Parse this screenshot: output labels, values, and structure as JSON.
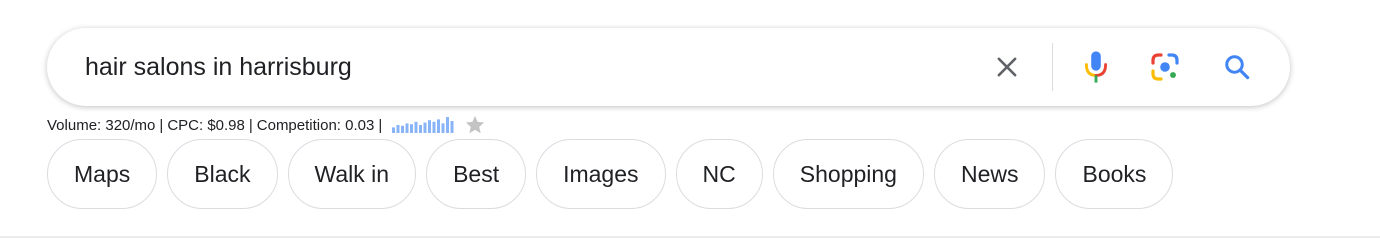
{
  "search": {
    "query": "hair salons in harrisburg"
  },
  "keyword_info": {
    "volume": "Volume: 320/mo",
    "cpc": "CPC: $0.98",
    "competition": "Competition: 0.03",
    "separator": "|",
    "trend_values": [
      0.35,
      0.5,
      0.45,
      0.6,
      0.55,
      0.7,
      0.5,
      0.65,
      0.8,
      0.7,
      0.85,
      0.6,
      1.0,
      0.75
    ]
  },
  "chips": [
    {
      "label": "Maps"
    },
    {
      "label": "Black"
    },
    {
      "label": "Walk in"
    },
    {
      "label": "Best"
    },
    {
      "label": "Images"
    },
    {
      "label": "NC"
    },
    {
      "label": "Shopping"
    },
    {
      "label": "News"
    },
    {
      "label": "Books"
    }
  ],
  "icons": {
    "clear": "close-icon",
    "voice": "microphone-icon",
    "lens": "camera-lens-icon",
    "search": "search-icon",
    "trend": "bar-chart-icon",
    "favorite": "star-icon"
  },
  "colors": {
    "blue": "#4285f4",
    "red": "#ea4335",
    "yellow": "#fbbc04",
    "green": "#34a853",
    "trend_bar": "#8ab4f8",
    "star": "#c4c4c4"
  }
}
